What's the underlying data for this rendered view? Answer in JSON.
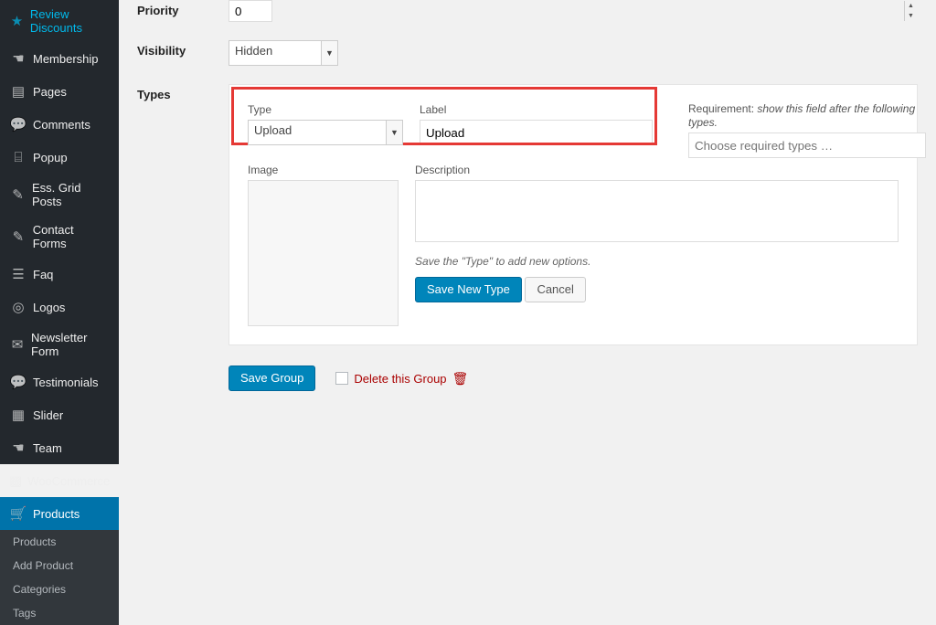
{
  "sidebar": {
    "items": [
      {
        "label": "Review Discounts",
        "glyph": "★"
      },
      {
        "label": "Membership",
        "glyph": "☚"
      },
      {
        "label": "Pages",
        "glyph": "▤"
      },
      {
        "label": "Comments",
        "glyph": "💬"
      },
      {
        "label": "Popup",
        "glyph": "⌸"
      },
      {
        "label": "Ess. Grid Posts",
        "glyph": "✎"
      },
      {
        "label": "Contact Forms",
        "glyph": "✎"
      },
      {
        "label": "Faq",
        "glyph": "☰"
      },
      {
        "label": "Logos",
        "glyph": "◎"
      },
      {
        "label": "Newsletter Form",
        "glyph": "✉"
      },
      {
        "label": "Testimonials",
        "glyph": "💬"
      },
      {
        "label": "Slider",
        "glyph": "▦"
      },
      {
        "label": "Team",
        "glyph": "☚"
      },
      {
        "label": "WooCommerce",
        "glyph": "▩"
      },
      {
        "label": "Products",
        "glyph": "🛒",
        "current": true
      }
    ],
    "submenu": [
      "Products",
      "Add Product",
      "Categories",
      "Tags"
    ]
  },
  "form": {
    "priority_label": "Priority",
    "priority_value": "0",
    "visibility_label": "Visibility",
    "visibility_value": "Hidden",
    "types_label": "Types",
    "type_field_label": "Type",
    "type_value": "Upload",
    "label_field_label": "Label",
    "label_value": "Upload",
    "image_label": "Image",
    "description_label": "Description",
    "hint": "Save the \"Type\" to add new options.",
    "save_new_type": "Save New Type",
    "cancel": "Cancel",
    "requirement_prefix": "Requirement: ",
    "requirement_italic": "show this field after the following types.",
    "requirement_placeholder": "Choose required types …",
    "save_group": "Save Group",
    "delete_group": "Delete this Group"
  }
}
